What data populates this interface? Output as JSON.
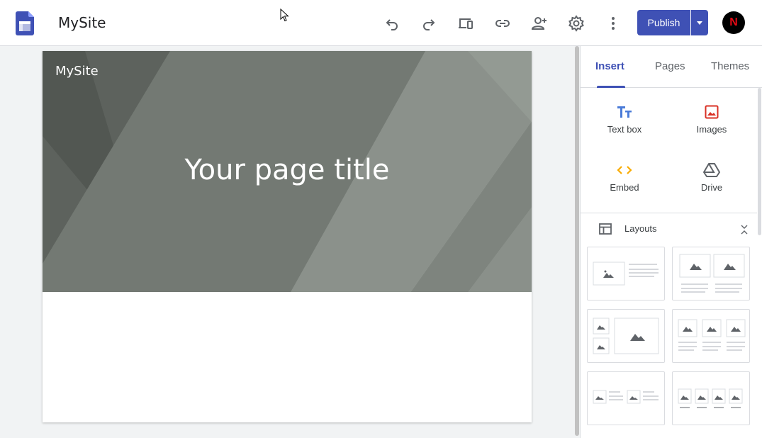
{
  "app": {
    "site_name": "MySite",
    "publish_label": "Publish",
    "avatar_letter": "N"
  },
  "toolbar": {
    "icons": [
      "undo-icon",
      "redo-icon",
      "preview-devices-icon",
      "link-icon",
      "share-user-icon",
      "settings-icon",
      "more-vert-icon"
    ]
  },
  "page": {
    "header_site_name": "MySite",
    "title": "Your page title"
  },
  "panel": {
    "tabs": [
      {
        "label": "Insert",
        "active": true
      },
      {
        "label": "Pages",
        "active": false
      },
      {
        "label": "Themes",
        "active": false
      }
    ],
    "insert_items": [
      {
        "label": "Text box",
        "icon": "text-box-icon"
      },
      {
        "label": "Images",
        "icon": "image-icon"
      },
      {
        "label": "Embed",
        "icon": "embed-icon"
      },
      {
        "label": "Drive",
        "icon": "drive-icon"
      }
    ],
    "layouts_label": "Layouts"
  },
  "colors": {
    "accent": "#3f51b5",
    "textbox_icon": "#4a7bd8",
    "images_icon": "#d93025",
    "embed_icon": "#f9ab00",
    "drive_icon": "#5f6368"
  }
}
